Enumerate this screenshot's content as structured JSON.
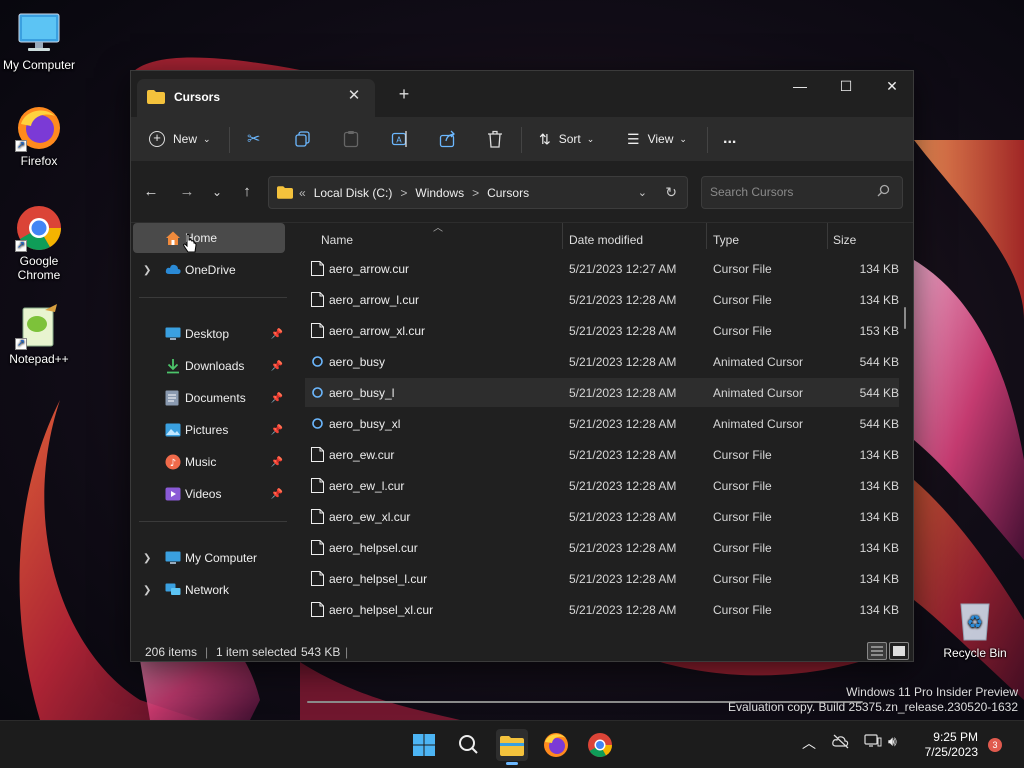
{
  "desktop": {
    "icons": [
      {
        "label": "My Computer"
      },
      {
        "label": "Firefox"
      },
      {
        "label": "Google Chrome"
      },
      {
        "label": "Notepad++"
      },
      {
        "label": "Recycle Bin"
      }
    ]
  },
  "window": {
    "tab_title": "Cursors",
    "toolbar": {
      "new_label": "New",
      "sort_label": "Sort",
      "view_label": "View",
      "more_label": "..."
    },
    "address": {
      "overflow": "«",
      "crumbs": [
        "Local Disk (C:)",
        "Windows",
        "Cursors"
      ],
      "separator": ">"
    },
    "search": {
      "placeholder": "Search Cursors"
    },
    "nav": {
      "home": "Home",
      "onedrive": "OneDrive",
      "quick": [
        "Desktop",
        "Downloads",
        "Documents",
        "Pictures",
        "Music",
        "Videos"
      ],
      "my_computer": "My Computer",
      "network": "Network"
    },
    "columns": {
      "name": "Name",
      "date": "Date modified",
      "type": "Type",
      "size": "Size"
    },
    "files": [
      {
        "name": "aero_arrow.cur",
        "date": "5/21/2023 12:27 AM",
        "type": "Cursor File",
        "size": "134 KB",
        "kind": "cur"
      },
      {
        "name": "aero_arrow_l.cur",
        "date": "5/21/2023 12:28 AM",
        "type": "Cursor File",
        "size": "134 KB",
        "kind": "cur"
      },
      {
        "name": "aero_arrow_xl.cur",
        "date": "5/21/2023 12:28 AM",
        "type": "Cursor File",
        "size": "153 KB",
        "kind": "cur"
      },
      {
        "name": "aero_busy",
        "date": "5/21/2023 12:28 AM",
        "type": "Animated Cursor",
        "size": "544 KB",
        "kind": "ani"
      },
      {
        "name": "aero_busy_l",
        "date": "5/21/2023 12:28 AM",
        "type": "Animated Cursor",
        "size": "544 KB",
        "kind": "ani"
      },
      {
        "name": "aero_busy_xl",
        "date": "5/21/2023 12:28 AM",
        "type": "Animated Cursor",
        "size": "544 KB",
        "kind": "ani"
      },
      {
        "name": "aero_ew.cur",
        "date": "5/21/2023 12:28 AM",
        "type": "Cursor File",
        "size": "134 KB",
        "kind": "cur"
      },
      {
        "name": "aero_ew_l.cur",
        "date": "5/21/2023 12:28 AM",
        "type": "Cursor File",
        "size": "134 KB",
        "kind": "cur"
      },
      {
        "name": "aero_ew_xl.cur",
        "date": "5/21/2023 12:28 AM",
        "type": "Cursor File",
        "size": "134 KB",
        "kind": "cur"
      },
      {
        "name": "aero_helpsel.cur",
        "date": "5/21/2023 12:28 AM",
        "type": "Cursor File",
        "size": "134 KB",
        "kind": "cur"
      },
      {
        "name": "aero_helpsel_l.cur",
        "date": "5/21/2023 12:28 AM",
        "type": "Cursor File",
        "size": "134 KB",
        "kind": "cur"
      },
      {
        "name": "aero_helpsel_xl.cur",
        "date": "5/21/2023 12:28 AM",
        "type": "Cursor File",
        "size": "134 KB",
        "kind": "cur"
      }
    ],
    "status": {
      "count": "206 items",
      "selected": "1 item selected",
      "size": "543 KB"
    }
  },
  "watermark": {
    "line1": "Windows 11 Pro Insider Preview",
    "line2": "Evaluation copy. Build 25375.zn_release.230520-1632"
  },
  "taskbar": {
    "time": "9:25 PM",
    "date": "7/25/2023",
    "notifications": "3"
  },
  "colors": {
    "accent": "#6cb8ff",
    "window_bg": "#202020",
    "toolbar_bg": "#2c2c2c"
  }
}
